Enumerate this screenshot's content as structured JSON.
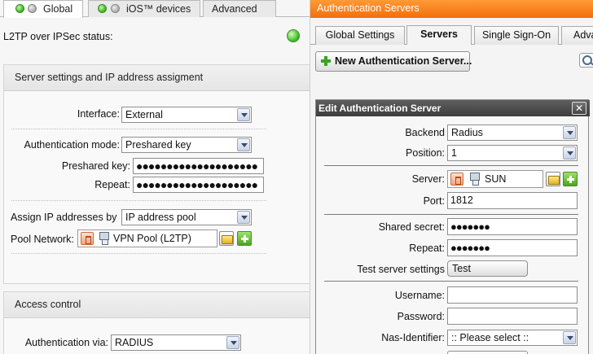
{
  "left": {
    "tabs": [
      {
        "label": "Global",
        "active": true
      },
      {
        "label": "iOS™ devices",
        "active": false
      },
      {
        "label": "Advanced",
        "active": false
      }
    ],
    "status_label": "L2TP over IPSec status:",
    "status_color": "#35b820",
    "server_section": {
      "title": "Server settings and IP address assigment",
      "interface_label": "Interface:",
      "interface_value": "External",
      "auth_mode_label": "Authentication mode:",
      "auth_mode_value": "Preshared key",
      "preshared_label": "Preshared key:",
      "preshared_value": "●●●●●●●●●●●●●●●●●●●●",
      "repeat_label": "Repeat:",
      "repeat_value": "●●●●●●●●●●●●●●●●●●●●",
      "assign_label": "Assign IP addresses by",
      "assign_value": "IP address pool",
      "pool_label": "Pool Network:",
      "pool_value": "VPN Pool (L2TP)"
    },
    "access_section": {
      "title": "Access control",
      "auth_via_label": "Authentication via:",
      "auth_via_value": "RADIUS"
    }
  },
  "right": {
    "title": "Authentication Servers",
    "title_color": "#f58220",
    "tabs": [
      {
        "label": "Global Settings",
        "active": false
      },
      {
        "label": "Servers",
        "active": true
      },
      {
        "label": "Single Sign-On",
        "active": false
      },
      {
        "label": "Adva",
        "active": false
      }
    ],
    "new_button": "New Authentication Server...",
    "dialog": {
      "title": "Edit Authentication Server",
      "close": "✕",
      "backend_label": "Backend",
      "backend_value": "Radius",
      "position_label": "Position:",
      "position_value": "1",
      "server_label": "Server:",
      "server_value": "SUN",
      "port_label": "Port:",
      "port_value": "1812",
      "secret_label": "Shared secret:",
      "secret_value": "●●●●●●●",
      "repeat_label": "Repeat:",
      "repeat_value": "●●●●●●●",
      "test_label": "Test server settings",
      "test_button": "Test",
      "username_label": "Username:",
      "username_value": "",
      "password_label": "Password:",
      "password_value": "",
      "nas_label": "Nas-Identifier:",
      "nas_value": ":: Please select ::"
    }
  }
}
